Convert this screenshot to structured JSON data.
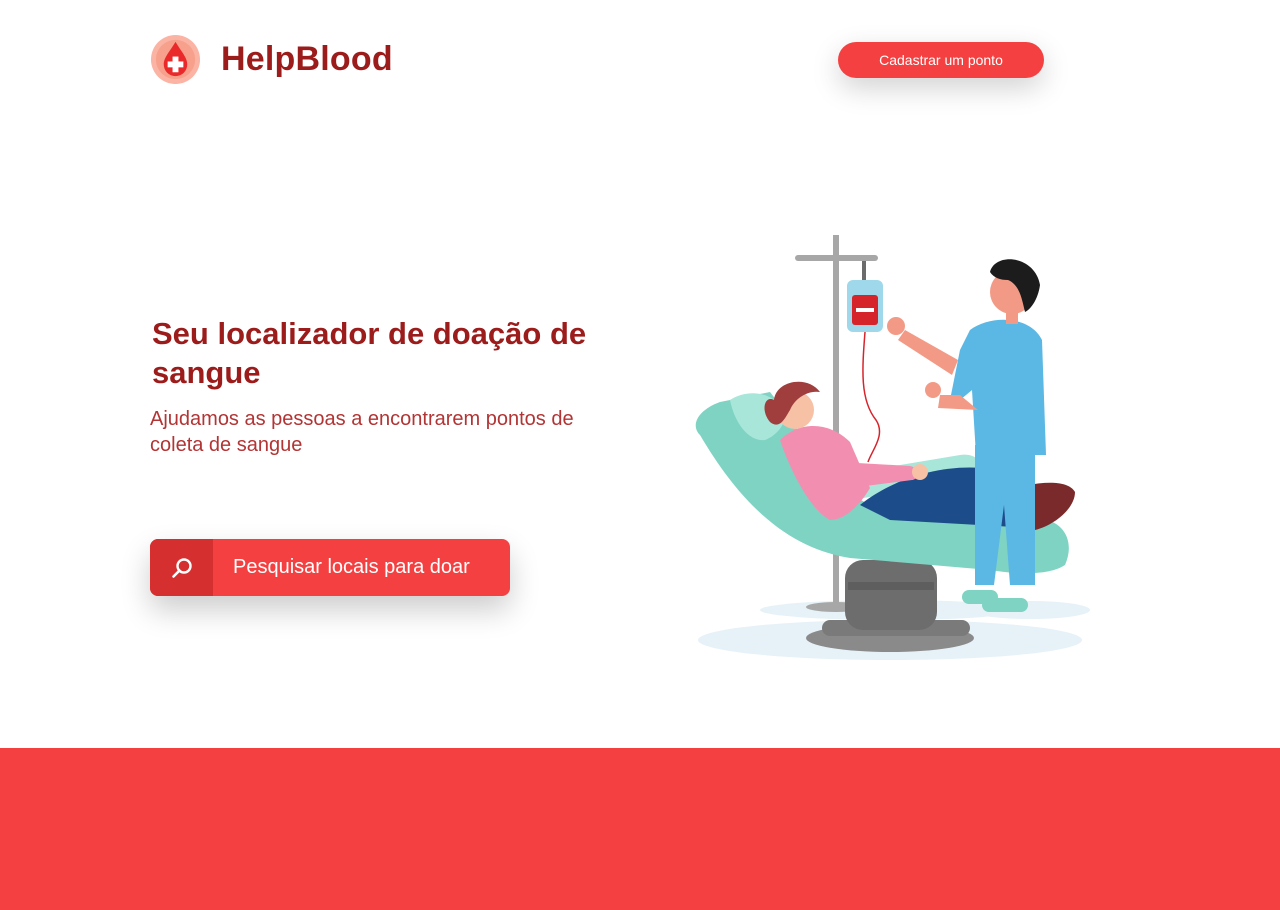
{
  "brand": {
    "name": "HelpBlood",
    "logo_icon": "blood-drop-cross-icon",
    "primary_color": "#f44040",
    "dark_red": "#9c1b1b"
  },
  "header": {
    "register_label": "Cadastrar um ponto"
  },
  "hero": {
    "title": "Seu localizador de doação de sangue",
    "subtitle": "Ajudamos as pessoas a encontrarem pontos de coleta de sangue",
    "search_label": "Pesquisar locais para doar",
    "search_icon": "search-icon",
    "illustration": "blood-donation-illustration"
  },
  "footer": {
    "color": "#f44040"
  }
}
